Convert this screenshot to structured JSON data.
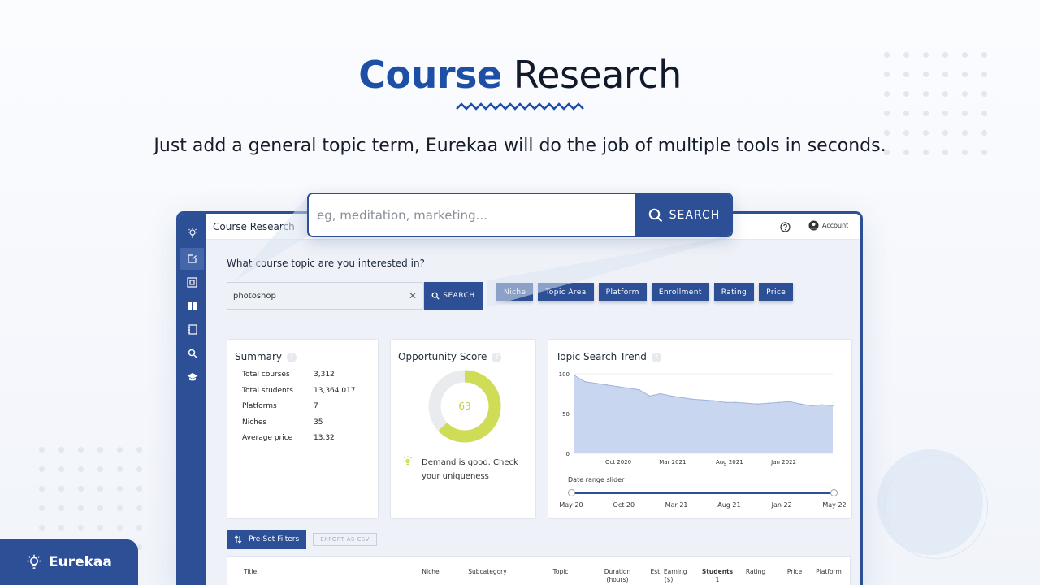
{
  "hero": {
    "title_strong": "Course",
    "title_rest": "Research",
    "subtitle": "Just add a general topic term, Eurekaa will do the job of multiple tools in seconds."
  },
  "big_search": {
    "placeholder": "eg, meditation, marketing...",
    "button_label": "SEARCH"
  },
  "app": {
    "page_title": "Course Research",
    "account_label": "Account",
    "sidebar_icons": [
      "bulb-icon",
      "edit-icon",
      "image-icon",
      "book-open-icon",
      "notebook-icon",
      "search-icon",
      "graduation-cap-icon"
    ],
    "question": "What course topic are you interested in?",
    "search": {
      "value": "photoshop",
      "button_label": "SEARCH"
    },
    "filters": [
      "Niche",
      "Topic Area",
      "Platform",
      "Enrollment",
      "Rating",
      "Price"
    ],
    "summary": {
      "title": "Summary",
      "rows": [
        {
          "label": "Total courses",
          "value": "3,312"
        },
        {
          "label": "Total students",
          "value": "13,364,017"
        },
        {
          "label": "Platforms",
          "value": "7"
        },
        {
          "label": "Niches",
          "value": "35"
        },
        {
          "label": "Average price",
          "value": "13.32"
        }
      ]
    },
    "opportunity": {
      "title": "Opportunity Score",
      "score": 63,
      "score_label": "63",
      "tip_line1": "Demand is good. Check",
      "tip_line2": "your uniqueness"
    },
    "trend": {
      "title": "Topic Search Trend",
      "slider_label": "Date range slider",
      "slider_ticks": [
        "May 20",
        "Oct 20",
        "Mar 21",
        "Aug 21",
        "Jan 22",
        "May 22"
      ]
    },
    "actions": {
      "preset_label": "Pre-Set Filters",
      "export_label": "EXPORT AS CSV"
    },
    "table_headers": [
      {
        "l1": "Title",
        "l2": ""
      },
      {
        "l1": "Niche",
        "l2": ""
      },
      {
        "l1": "Subcategory",
        "l2": ""
      },
      {
        "l1": "Topic",
        "l2": ""
      },
      {
        "l1": "Duration",
        "l2": "(hours)"
      },
      {
        "l1": "Est. Earning",
        "l2": "($)"
      },
      {
        "l1": "Students",
        "l2": "1"
      },
      {
        "l1": "Rating",
        "l2": ""
      },
      {
        "l1": "Price",
        "l2": ""
      },
      {
        "l1": "Platform",
        "l2": ""
      }
    ]
  },
  "brand": {
    "name": "Eurekaa"
  },
  "colors": {
    "primary": "#2c4f96",
    "title_blue": "#1d4fa6",
    "donut_green": "#cfdc56",
    "area_fill": "#c9d6ef"
  },
  "chart_data": {
    "type": "area",
    "title": "Topic Search Trend",
    "xlabel": "",
    "ylabel": "",
    "ylim": [
      0,
      100
    ],
    "yticks": [
      "0",
      "50",
      "100"
    ],
    "xticks": [
      "Oct 2020",
      "Mar 2021",
      "Aug 2021",
      "Jan 2022"
    ],
    "grid": true,
    "series": [
      {
        "x": [
          "2020-05",
          "2020-06",
          "2020-07",
          "2020-08",
          "2020-09",
          "2020-10",
          "2020-11",
          "2020-12",
          "2021-01",
          "2021-02",
          "2021-03",
          "2021-04",
          "2021-05",
          "2021-06",
          "2021-07",
          "2021-08",
          "2021-09",
          "2021-10",
          "2021-11",
          "2021-12",
          "2022-01",
          "2022-02",
          "2022-03",
          "2022-04",
          "2022-05"
        ],
        "values": [
          98,
          90,
          88,
          86,
          84,
          82,
          80,
          72,
          75,
          72,
          70,
          68,
          67,
          66,
          64,
          64,
          63,
          62,
          63,
          64,
          65,
          62,
          60,
          61,
          60
        ]
      }
    ]
  }
}
